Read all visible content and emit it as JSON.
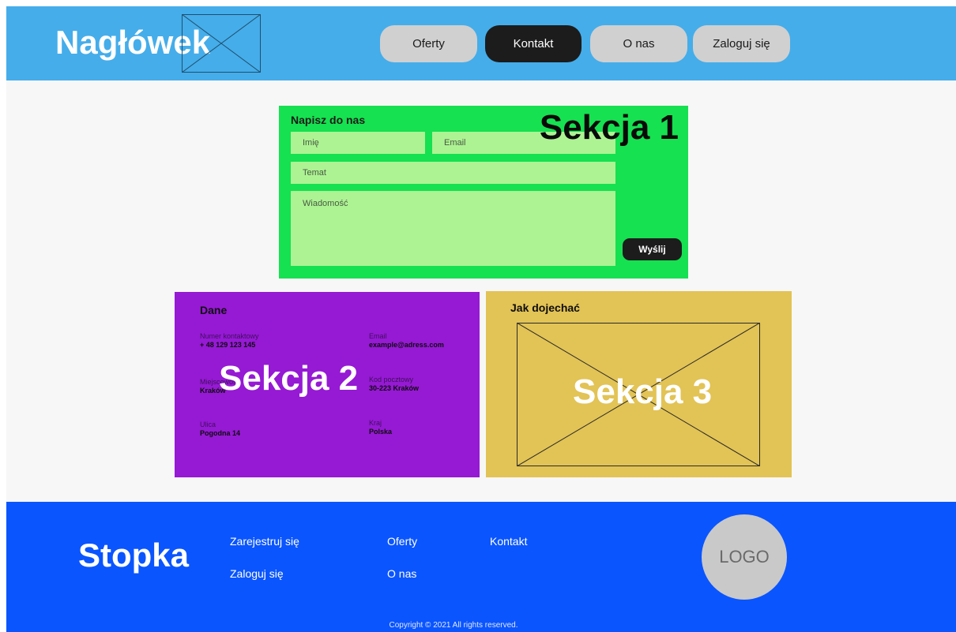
{
  "header": {
    "title": "Nagłówek",
    "nav": [
      {
        "label": "Oferty",
        "active": false
      },
      {
        "label": "Kontakt",
        "active": true
      },
      {
        "label": "O nas",
        "active": false
      },
      {
        "label": "Zaloguj się",
        "active": false
      }
    ]
  },
  "section1": {
    "heading": "Napisz do nas",
    "watermark": "Sekcja 1",
    "name_placeholder": "Imię",
    "email_placeholder": "Email",
    "subject_placeholder": "Temat",
    "message_placeholder": "Wiadomość",
    "send_label": "Wyślij"
  },
  "section2": {
    "heading": "Dane",
    "watermark": "Sekcja 2",
    "phone_label": "Numer kontaktowy",
    "phone_value": "+ 48 129 123 145",
    "email_label": "Email",
    "email_value": "example@adress.com",
    "city_label": "Miejscowość",
    "city_value": "Kraków",
    "postal_label": "Kod pocztowy",
    "postal_value": "30-223 Kraków",
    "street_label": "Ulica",
    "street_value": "Pogodna 14",
    "country_label": "Kraj",
    "country_value": "Polska"
  },
  "section3": {
    "heading": "Jak dojechać",
    "watermark": "Sekcja 3"
  },
  "footer": {
    "title": "Stopka",
    "links": [
      "Zarejestruj się",
      "Zaloguj się",
      "Oferty",
      "O nas",
      "Kontakt"
    ],
    "logo": "LOGO",
    "copyright": "Copyright © 2021 All rights reserved."
  },
  "colors": {
    "header_bg": "#45adea",
    "section1_bg": "#16e150",
    "section2_bg": "#9619d4",
    "section3_bg": "#e2c355",
    "footer_bg": "#0a55fe",
    "active_nav": "#1c1c1c"
  }
}
